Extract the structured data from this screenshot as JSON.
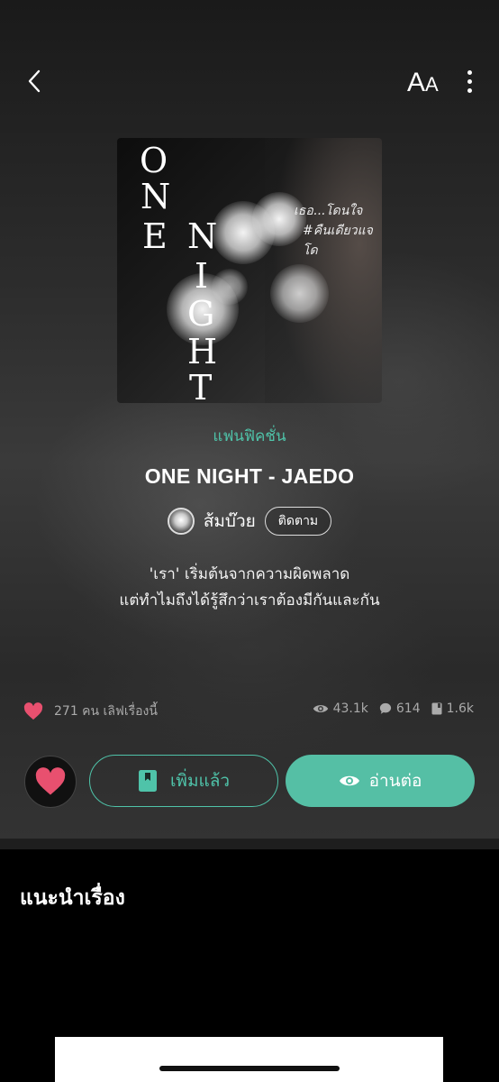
{
  "header": {
    "font_big": "A",
    "font_small": "A",
    "icons": {
      "back": "chevron-left-icon",
      "font": "font-size-icon",
      "more": "more-vertical-icon"
    }
  },
  "cover": {
    "title_letters": [
      "O",
      "N",
      "E",
      "N",
      "I",
      "G",
      "H",
      "T"
    ],
    "tagline_1": "เธอ...โดนใจ",
    "tagline_2": "#คืนเดียวแจโด"
  },
  "story": {
    "category": "แฟนฟิคชั่น",
    "title": "ONE NIGHT - JAEDO",
    "author": "ส้มบ๊วย",
    "follow_label": "ติดตาม",
    "synopsis_line1": "'เรา' เริ่มต้นจากความผิดพลาด",
    "synopsis_line2": "แต่ทำไมถึงได้รู้สึกว่าเราต้องมีกันและกัน"
  },
  "stats": {
    "love_text": "271 คน เลิฟเรื่องนี้",
    "views": "43.1k",
    "comments": "614",
    "chapters": "1.6k"
  },
  "actions": {
    "added_label": "เพิ่มแล้ว",
    "read_label": "อ่านต่อ"
  },
  "recommend": {
    "title": "แนะนำเรื่อง"
  },
  "colors": {
    "accent": "#4fc3a9",
    "read_button": "#55bfa5",
    "heart": "#e8506f"
  }
}
